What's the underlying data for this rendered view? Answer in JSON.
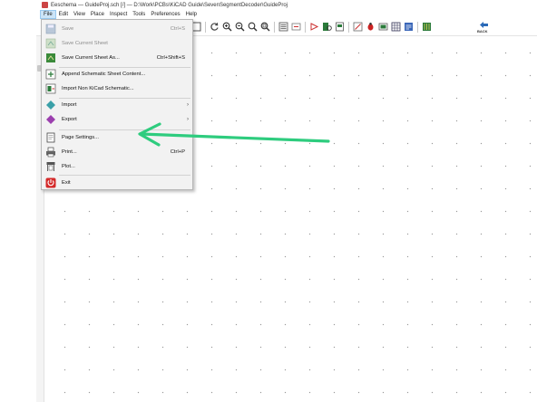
{
  "window": {
    "title": "Eeschema — GuideProj.sch [/] — D:\\Work\\PCBs\\KiCAD Guide\\SevenSegmentDecoder\\GuideProj"
  },
  "menubar": {
    "items": [
      "File",
      "Edit",
      "View",
      "Place",
      "Inspect",
      "Tools",
      "Preferences",
      "Help"
    ],
    "active": "File"
  },
  "toolbar": {
    "back_label": "BACK"
  },
  "file_menu": {
    "items": [
      {
        "label": "Save",
        "shortcut": "Ctrl+S",
        "enabled": false,
        "icon": "save-icon"
      },
      {
        "label": "Save Current Sheet",
        "shortcut": "",
        "enabled": false,
        "icon": "save-sheet-icon"
      },
      {
        "label": "Save Current Sheet As...",
        "shortcut": "Ctrl+Shift+S",
        "enabled": true,
        "icon": "save-as-icon"
      },
      {
        "label": "Append Schematic Sheet Content...",
        "shortcut": "",
        "enabled": true,
        "icon": "append-icon"
      },
      {
        "label": "Import Non KiCad Schematic...",
        "shortcut": "",
        "enabled": true,
        "icon": "import-schematic-icon"
      },
      {
        "label": "Import",
        "shortcut": "",
        "enabled": true,
        "submenu": true,
        "icon": "import-icon"
      },
      {
        "label": "Export",
        "shortcut": "",
        "enabled": true,
        "submenu": true,
        "icon": "export-icon"
      },
      {
        "label": "Page Settings...",
        "shortcut": "",
        "enabled": true,
        "icon": "page-settings-icon"
      },
      {
        "label": "Print...",
        "shortcut": "Ctrl+P",
        "enabled": true,
        "icon": "print-icon"
      },
      {
        "label": "Plot...",
        "shortcut": "",
        "enabled": true,
        "icon": "plot-icon"
      },
      {
        "label": "Exit",
        "shortcut": "",
        "enabled": true,
        "icon": "exit-icon"
      }
    ],
    "submenu_arrow": "›"
  },
  "colors": {
    "callout_arrow": "#2ecc7e",
    "menu_highlight": "#cce4f7",
    "exit_red": "#d42a2a"
  }
}
